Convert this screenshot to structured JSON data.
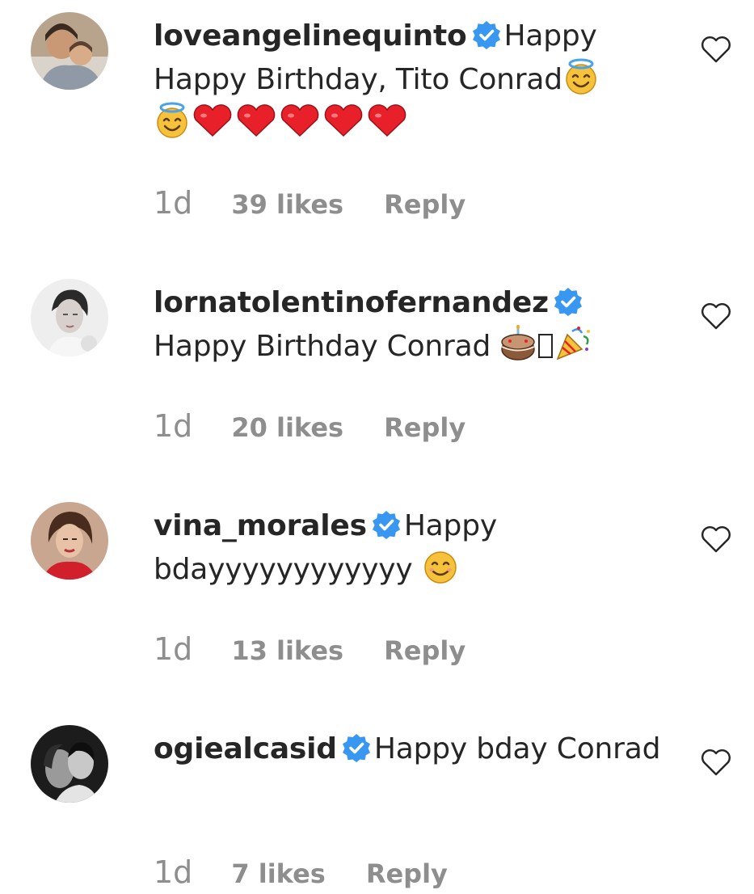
{
  "colors": {
    "text": "#262626",
    "muted": "#8e8e8e",
    "verified_blue": "#3897f0",
    "heart_red": "#e8202a",
    "emoji_yellow": "#f7c23b"
  },
  "comments": [
    {
      "username": "loveangelinequinto",
      "verified": true,
      "text_part1": "Happy Happy Birthday, Tito Conrad",
      "emojis": [
        "smiling-face-with-halo-emoji",
        "smiling-face-with-halo-emoji",
        "red-heart-emoji",
        "red-heart-emoji",
        "red-heart-emoji",
        "red-heart-emoji",
        "red-heart-emoji"
      ],
      "time": "1d",
      "likes": "39 likes",
      "reply": "Reply"
    },
    {
      "username": "lornatolentinofernandez",
      "verified": true,
      "text_part1": "Happy Birthday Conrad",
      "emojis": [
        "birthday-cake-emoji",
        "party-popper-emoji"
      ],
      "time": "1d",
      "likes": "20 likes",
      "reply": "Reply"
    },
    {
      "username": "vina_morales",
      "verified": true,
      "text_part1": "Happy bdayyyyyyyyyyyy",
      "emojis": [
        "smiling-face-emoji"
      ],
      "time": "1d",
      "likes": "13 likes",
      "reply": "Reply"
    },
    {
      "username": "ogiealcasid",
      "verified": true,
      "text_part1": "Happy bday Conrad",
      "emojis": [],
      "time": "1d",
      "likes": "7 likes",
      "reply": "Reply"
    }
  ]
}
